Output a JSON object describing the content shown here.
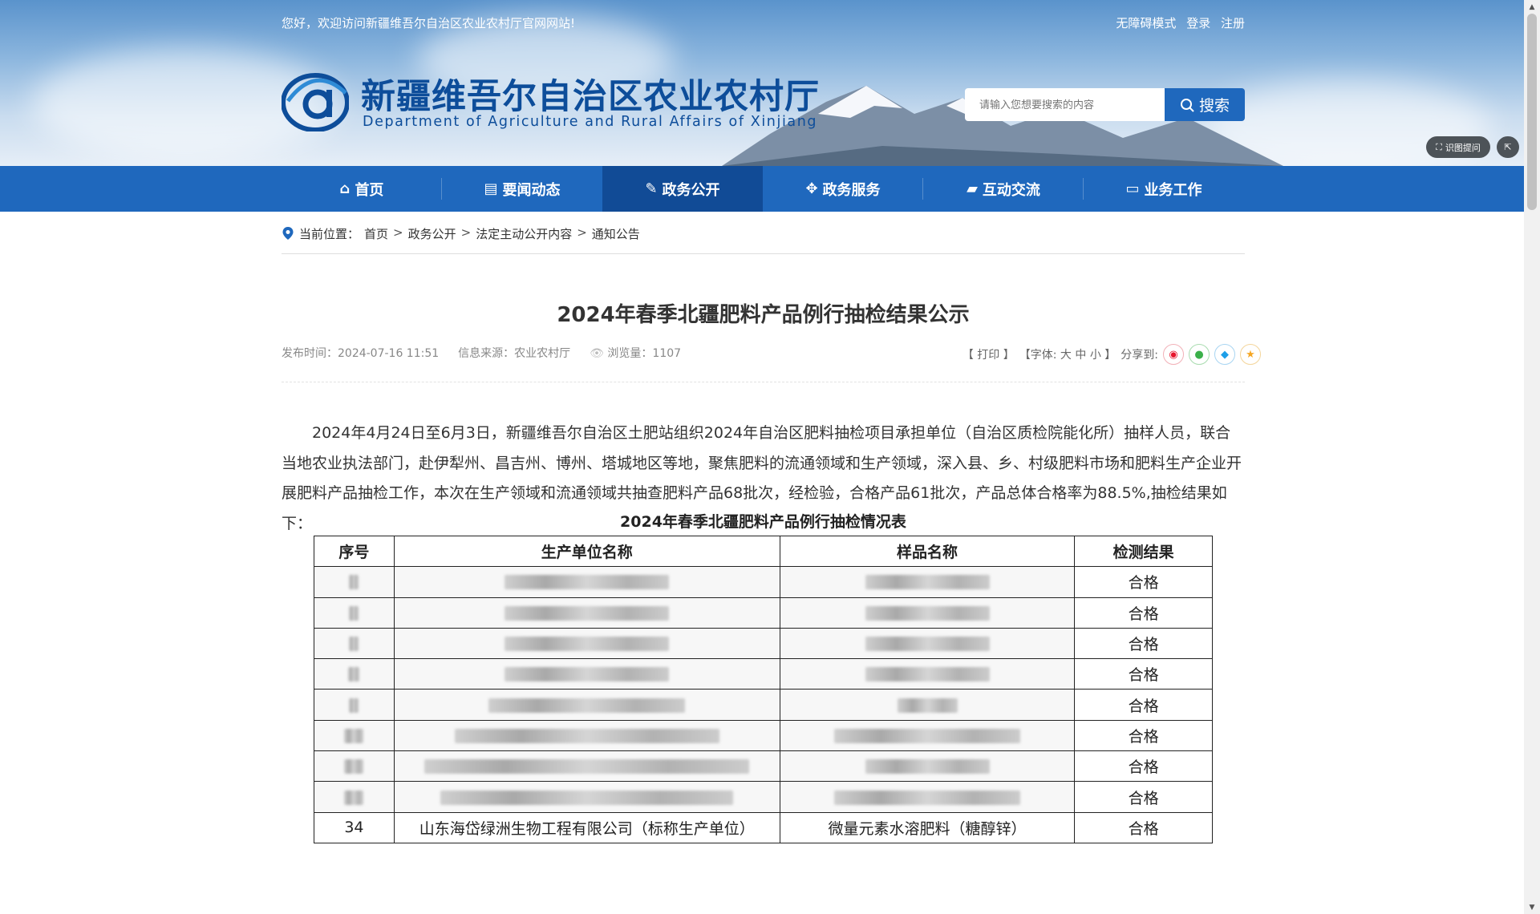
{
  "header": {
    "welcome": "您好，欢迎访问新疆维吾尔自治区农业农村厅官网网站!",
    "links": [
      "无障碍模式",
      "登录",
      "注册"
    ],
    "site_title": "新疆维吾尔自治区农业农村厅",
    "site_subtitle": "Department of Agriculture and Rural Affairs of Xinjiang",
    "search_placeholder": "请输入您想要搜索的内容",
    "search_button": "搜索",
    "tool_ocr": "识图提问",
    "tool_share": "",
    "colors": {
      "nav": "#1f68bd",
      "nav_active": "#114b96",
      "title": "#0d4d9a"
    }
  },
  "nav": {
    "items": [
      {
        "label": "首页",
        "icon": "home-icon"
      },
      {
        "label": "要闻动态",
        "icon": "news-icon"
      },
      {
        "label": "政务公开",
        "icon": "document-icon"
      },
      {
        "label": "政务服务",
        "icon": "grid-icon"
      },
      {
        "label": "互动交流",
        "icon": "chat-icon"
      },
      {
        "label": "业务工作",
        "icon": "monitor-icon"
      }
    ],
    "active": "政务公开"
  },
  "breadcrumb": {
    "label": "当前位置：",
    "items": [
      "首页",
      "政务公开",
      "法定主动公开内容",
      "通知公告"
    ]
  },
  "article": {
    "title": "2024年春季北疆肥料产品例行抽检结果公示",
    "publish_label": "发布时间：",
    "publish_time": "2024-07-16 11:51",
    "source_label": "信息来源：",
    "source": "农业农村厅",
    "views_label": "浏览量：",
    "views": "1107",
    "print": "【 打印 】",
    "font_size": "【字体: 大 中 小 】",
    "share_label": "分享到:",
    "share_icons": [
      "weibo-icon",
      "wechat-icon",
      "qq-icon",
      "favorite-icon"
    ],
    "paragraph": "2024年4月24日至6月3日，新疆维吾尔自治区土肥站组织2024年自治区肥料抽检项目承担单位（自治区质检院能化所）抽样人员，联合当地农业执法部门，赴伊犁州、昌吉州、博州、塔城地区等地，聚焦肥料的流通领域和生产领域，深入县、乡、村级肥料市场和肥料生产企业开展肥料产品抽检工作，本次在生产领域和流通领域共抽查肥料产品68批次，经检验，合格产品61批次，产品总体合格率为88.5%,抽检结果如下：",
    "table_caption": "2024年春季北疆肥料产品例行抽检情况表"
  },
  "table": {
    "headers": [
      "序号",
      "生产单位名称",
      "样品名称",
      "检测结果"
    ],
    "rows": [
      {
        "no": "",
        "company": "",
        "sample": "",
        "result": "合格",
        "blurred": true
      },
      {
        "no": "",
        "company": "",
        "sample": "",
        "result": "合格",
        "blurred": true
      },
      {
        "no": "",
        "company": "",
        "sample": "",
        "result": "合格",
        "blurred": true
      },
      {
        "no": "",
        "company": "",
        "sample": "",
        "result": "合格",
        "blurred": true
      },
      {
        "no": "",
        "company": "",
        "sample": "",
        "result": "合格",
        "blurred": true
      },
      {
        "no": "",
        "company": "",
        "sample": "",
        "result": "合格",
        "blurred": true
      },
      {
        "no": "",
        "company": "",
        "sample": "",
        "result": "合格",
        "blurred": true
      },
      {
        "no": "",
        "company": "",
        "sample": "",
        "result": "合格",
        "blurred": true
      },
      {
        "no": "34",
        "company": "山东海岱绿洲生物工程有限公司（标称生产单位）",
        "sample": "微量元素水溶肥料（糖醇锌）",
        "result": "合格",
        "blurred": false
      }
    ]
  }
}
